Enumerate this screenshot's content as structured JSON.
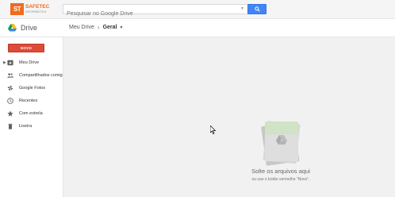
{
  "brand": {
    "mark": "ST",
    "name": "SAFETEC",
    "tagline": "INFORMÁTICA"
  },
  "search": {
    "placeholder": "Pesquisar no Google Drive",
    "value": ""
  },
  "header": {
    "app_title": "Drive",
    "breadcrumb_root": "Meu Drive",
    "breadcrumb_sep": "›",
    "breadcrumb_current": "Geral"
  },
  "sidebar": {
    "new_label": "NOVO",
    "items": [
      {
        "label": "Meu Drive",
        "icon": "my-drive-icon"
      },
      {
        "label": "Compartilhados comigo",
        "icon": "people-icon"
      },
      {
        "label": "Google Fotos",
        "icon": "pinwheel-icon"
      },
      {
        "label": "Recentes",
        "icon": "clock-icon"
      },
      {
        "label": "Com estrela",
        "icon": "star-icon"
      },
      {
        "label": "Lixeira",
        "icon": "trash-icon"
      }
    ]
  },
  "main": {
    "drop_title": "Solte os arquivos aqui",
    "drop_subtitle": "ou use o botão vermelho \"Novo\"."
  },
  "colors": {
    "brand": "#f26b1d",
    "search_button": "#4285f4",
    "new_button": "#dd4b39"
  }
}
